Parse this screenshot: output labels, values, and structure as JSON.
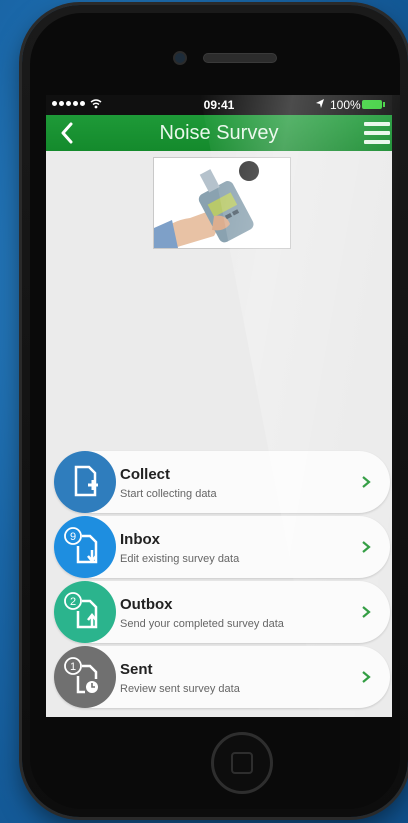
{
  "status_bar": {
    "time": "09:41",
    "battery": "100%"
  },
  "nav": {
    "title": "Noise Survey"
  },
  "items": [
    {
      "title": "Collect",
      "subtitle": "Start collecting data",
      "color": "#2f7dbd",
      "badge": ""
    },
    {
      "title": "Inbox",
      "subtitle": "Edit existing survey data",
      "color": "#1e8ee0",
      "badge": "9"
    },
    {
      "title": "Outbox",
      "subtitle": "Send your completed survey data",
      "color": "#2bb48d",
      "badge": "2"
    },
    {
      "title": "Sent",
      "subtitle": "Review sent survey data",
      "color": "#707070",
      "badge": "1"
    }
  ]
}
